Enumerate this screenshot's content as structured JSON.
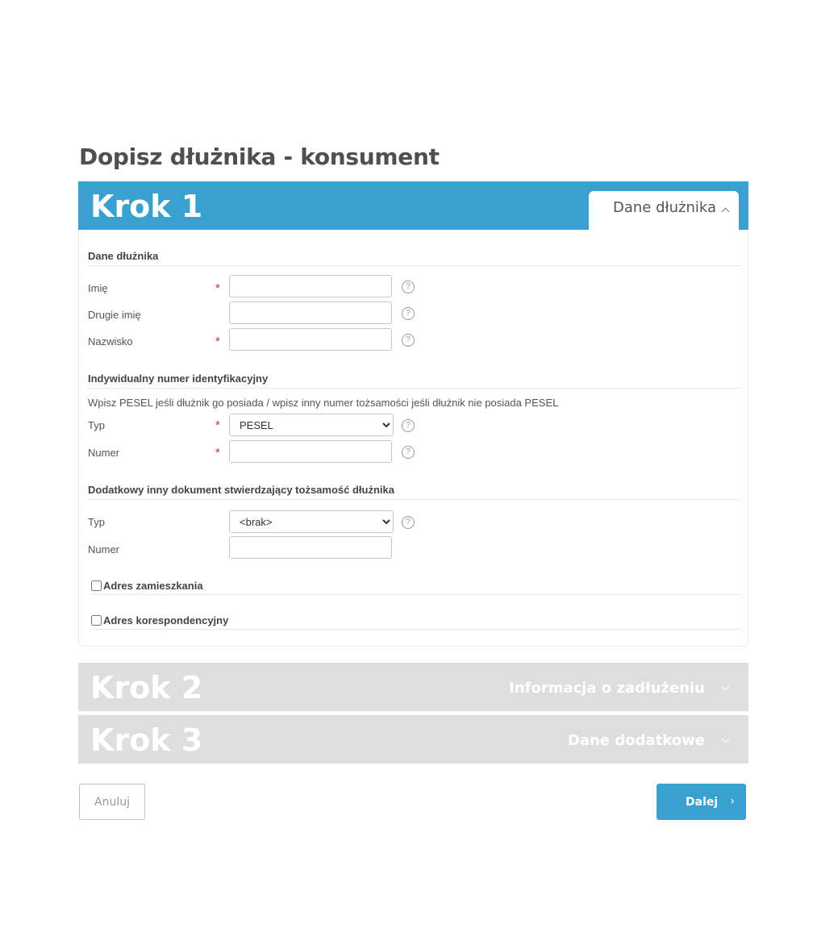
{
  "page": {
    "title": "Dopisz dłużnika - konsument"
  },
  "colors": {
    "accent": "#38a1d0",
    "inactive_step": "#dedede",
    "required": "#c0392b"
  },
  "steps": [
    {
      "number": "Krok 1",
      "label": "Dane dłużnika",
      "state": "expanded",
      "icon": "chevron-up-icon"
    },
    {
      "number": "Krok 2",
      "label": "Informacja o zadłużeniu",
      "state": "collapsed",
      "icon": "chevron-down-icon"
    },
    {
      "number": "Krok 3",
      "label": "Dane dodatkowe",
      "state": "collapsed",
      "icon": "chevron-down-icon"
    }
  ],
  "debtor": {
    "heading": "Dane dłużnika",
    "fields": {
      "first_name": {
        "label": "Imię",
        "required_mark": "*",
        "value": ""
      },
      "middle_name": {
        "label": "Drugie imię",
        "value": ""
      },
      "last_name": {
        "label": "Nazwisko",
        "required_mark": "*",
        "value": ""
      }
    }
  },
  "identifier": {
    "heading": "Indywidualny numer identyfikacyjny",
    "note": "Wpisz PESEL jeśli dłużnik go posiada / wpisz inny numer tożsamości jeśli dłużnik nie posiada PESEL",
    "type": {
      "label": "Typ",
      "required_mark": "*",
      "selected": "PESEL"
    },
    "number": {
      "label": "Numer",
      "required_mark": "*",
      "value": ""
    }
  },
  "extra_document": {
    "heading": "Dodatkowy inny dokument stwierdzający tożsamość dłużnika",
    "type": {
      "label": "Typ",
      "selected": "<brak>"
    },
    "number": {
      "label": "Numer",
      "value": ""
    }
  },
  "addresses": {
    "residence": {
      "label": "Adres zamieszkania",
      "checked": false
    },
    "correspondence": {
      "label": "Adres korespondencyjny",
      "checked": false
    }
  },
  "help_glyph": "?",
  "actions": {
    "cancel": "Anuluj",
    "next": "Dalej",
    "next_arrow": "›"
  }
}
